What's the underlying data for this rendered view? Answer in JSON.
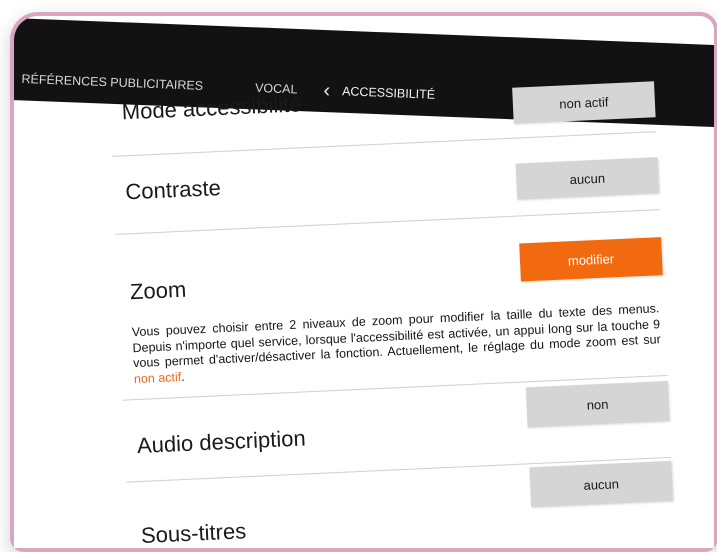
{
  "nav": {
    "items": [
      "RÉFÉRENCES PUBLICITAIRES",
      "VOCAL"
    ],
    "back_icon": "chevron-left-icon",
    "current": "ACCESSIBILITÉ"
  },
  "settings": [
    {
      "label": "Mode accessibilité",
      "value": "non actif"
    },
    {
      "label": "Contraste",
      "value": "aucun"
    },
    {
      "label": "Zoom",
      "value": "modifier"
    },
    {
      "label": "Audio description",
      "value": "non"
    },
    {
      "label": "Sous-titres",
      "value": "aucun"
    }
  ],
  "zoom_description": {
    "text": "Vous pouvez choisir entre 2 niveaux de zoom pour modifier la taille du texte des menus. Depuis n'importe quel service, lorsque l'accessibilité est activée, un appui long sur la touche 9 vous permet d'activer/désactiver la fonction. Actuellement, le réglage du mode zoom est sur ",
    "status": "non actif",
    "end": "."
  },
  "colors": {
    "accent": "#f26a10",
    "bar": "#121212",
    "button": "#d5d5d5",
    "frame": "#d9a6bf"
  }
}
